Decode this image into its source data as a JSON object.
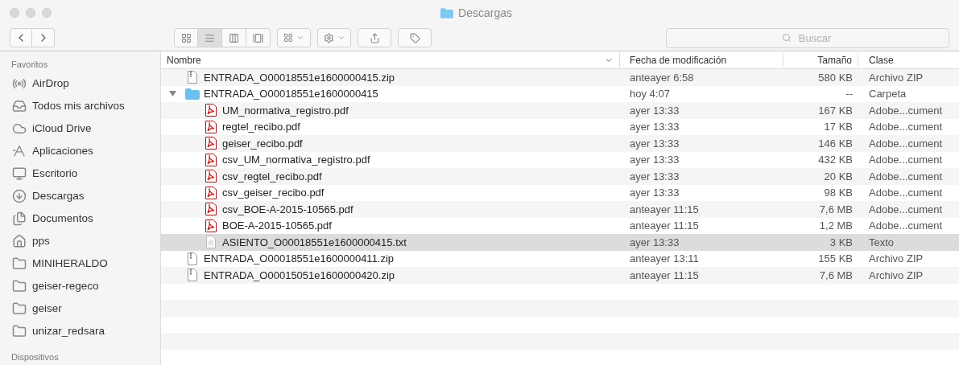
{
  "window": {
    "title": "Descargas"
  },
  "toolbar": {
    "view_buttons": [
      {
        "kind": "icons",
        "selected": false
      },
      {
        "kind": "list",
        "selected": true
      },
      {
        "kind": "columns",
        "selected": false
      },
      {
        "kind": "cover",
        "selected": false
      }
    ],
    "search": {
      "placeholder": "Buscar"
    }
  },
  "sidebar": {
    "sections": [
      {
        "title": "Favoritos",
        "items": [
          {
            "label": "AirDrop",
            "kind": "airdrop"
          },
          {
            "label": "Todos mis archivos",
            "kind": "all"
          },
          {
            "label": "iCloud Drive",
            "kind": "icloud"
          },
          {
            "label": "Aplicaciones",
            "kind": "apps"
          },
          {
            "label": "Escritorio",
            "kind": "desktop"
          },
          {
            "label": "Descargas",
            "kind": "downloads"
          },
          {
            "label": "Documentos",
            "kind": "documents"
          },
          {
            "label": "pps",
            "kind": "home"
          },
          {
            "label": "MINIHERALDO",
            "kind": "folder"
          },
          {
            "label": "geiser-regeco",
            "kind": "folder"
          },
          {
            "label": "geiser",
            "kind": "folder"
          },
          {
            "label": "unizar_redsara",
            "kind": "folder"
          }
        ]
      },
      {
        "title": "Dispositivos"
      }
    ]
  },
  "table": {
    "columns": [
      {
        "label": "Nombre",
        "sorted": true
      },
      {
        "label": "Fecha de modificación",
        "sorted": false
      },
      {
        "label": "Tamaño",
        "sorted": false
      },
      {
        "label": "Clase",
        "sorted": false
      }
    ],
    "rows": [
      {
        "kind": "zip",
        "name": "ENTRADA_O00018551e1600000415.zip",
        "date": "anteayer 6:58",
        "size": "580 KB",
        "type": "Archivo ZIP",
        "selected": false
      },
      {
        "kind": "folder",
        "name": "ENTRADA_O00018551e1600000415",
        "date": "hoy 4:07",
        "size": "--",
        "type": "Carpeta",
        "selected": false,
        "expanded": true,
        "children": [
          {
            "kind": "pdf",
            "name": "UM_normativa_registro.pdf",
            "date": "ayer 13:33",
            "size": "167 KB",
            "type": "Adobe...cument",
            "selected": false
          },
          {
            "kind": "pdf",
            "name": "regtel_recibo.pdf",
            "date": "ayer 13:33",
            "size": "17 KB",
            "type": "Adobe...cument",
            "selected": false
          },
          {
            "kind": "pdf",
            "name": "geiser_recibo.pdf",
            "date": "ayer 13:33",
            "size": "146 KB",
            "type": "Adobe...cument",
            "selected": false
          },
          {
            "kind": "pdf",
            "name": "csv_UM_normativa_registro.pdf",
            "date": "ayer 13:33",
            "size": "432 KB",
            "type": "Adobe...cument",
            "selected": false
          },
          {
            "kind": "pdf",
            "name": "csv_regtel_recibo.pdf",
            "date": "ayer 13:33",
            "size": "20 KB",
            "type": "Adobe...cument",
            "selected": false
          },
          {
            "kind": "pdf",
            "name": "csv_geiser_recibo.pdf",
            "date": "ayer 13:33",
            "size": "98 KB",
            "type": "Adobe...cument",
            "selected": false
          },
          {
            "kind": "pdf",
            "name": "csv_BOE-A-2015-10565.pdf",
            "date": "anteayer 11:15",
            "size": "7,6 MB",
            "type": "Adobe...cument",
            "selected": false
          },
          {
            "kind": "pdf",
            "name": "BOE-A-2015-10565.pdf",
            "date": "anteayer 11:15",
            "size": "1,2 MB",
            "type": "Adobe...cument",
            "selected": false
          },
          {
            "kind": "txt",
            "name": "ASIENTO_O00018551e1600000415.txt",
            "date": "ayer 13:33",
            "size": "3 KB",
            "type": "Texto",
            "selected": true
          }
        ]
      },
      {
        "kind": "zip",
        "name": "ENTRADA_O00018551e1600000411.zip",
        "date": "anteayer 13:11",
        "size": "155 KB",
        "type": "Archivo ZIP",
        "selected": false
      },
      {
        "kind": "zip",
        "name": "ENTRADA_O00015051e1600000420.zip",
        "date": "anteayer 11:15",
        "size": "7,6 MB",
        "type": "Archivo ZIP",
        "selected": false
      }
    ]
  }
}
